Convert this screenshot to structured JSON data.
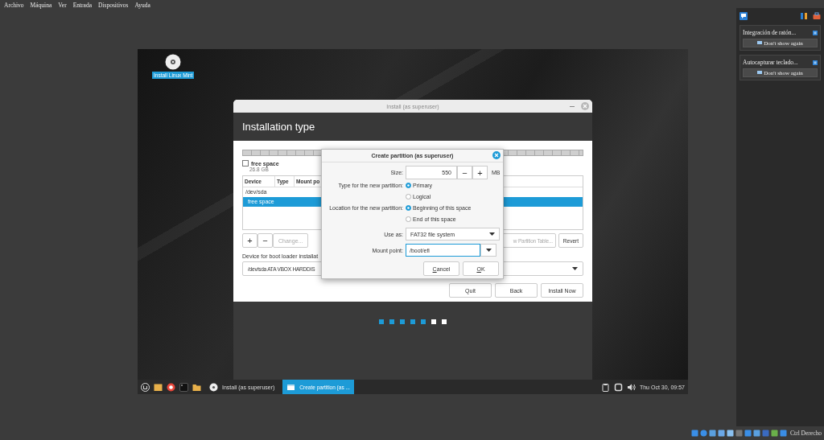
{
  "menubar": {
    "items": [
      "Archivo",
      "Máquina",
      "Ver",
      "Entrada",
      "Dispositivos",
      "Ayuda"
    ]
  },
  "desktop": {
    "icon_label": "Install Linux Mint"
  },
  "installer": {
    "title": "Install (as superuser)",
    "heading": "Installation type",
    "legend": {
      "label": "free space",
      "size": "26.8 GB"
    },
    "columns": [
      "Device",
      "Type",
      "Mount po"
    ],
    "rows": [
      {
        "device": "/dev/sda",
        "selected": false
      },
      {
        "device": "free space",
        "selected": true
      }
    ],
    "partition_buttons": [
      {
        "label": "+",
        "disabled": false
      },
      {
        "label": "−",
        "disabled": false
      },
      {
        "label": "Change...",
        "disabled": true
      }
    ],
    "table_button": {
      "label": "w Partition Table...",
      "disabled": true
    },
    "revert_button": "Revert",
    "bootloader_label": "Device for boot loader installat",
    "bootloader_value": "/dev/sda ATA VBOX HARDDIS",
    "nav_buttons": [
      "Quit",
      "Back",
      "Install Now"
    ],
    "steps": [
      {
        "done": true
      },
      {
        "done": true
      },
      {
        "done": true
      },
      {
        "done": true
      },
      {
        "done": true
      },
      {
        "done": false
      },
      {
        "done": false
      }
    ]
  },
  "dialog": {
    "title": "Create partition (as superuser)",
    "size": {
      "label": "Size:",
      "value": "550",
      "unit": "MB",
      "decrement": "−",
      "increment": "+"
    },
    "type": {
      "label": "Type for the new partition:",
      "options": [
        {
          "label": "Primary",
          "selected": true
        },
        {
          "label": "Logical",
          "selected": false
        }
      ]
    },
    "location": {
      "label": "Location for the new partition:",
      "options": [
        {
          "label": "Beginning of this space",
          "selected": true
        },
        {
          "label": "End of this space",
          "selected": false
        }
      ]
    },
    "use_as": {
      "label": "Use as:",
      "value": "FAT32 file system"
    },
    "mount_point": {
      "label": "Mount point:",
      "value": "/boot/efi"
    },
    "buttons": [
      "Cancel",
      "OK"
    ]
  },
  "taskbar": {
    "tasks": [
      {
        "label": "Install (as superuser)",
        "active": false,
        "kind": "disc"
      },
      {
        "label": "Create partition (as ...",
        "active": true,
        "kind": "window"
      }
    ],
    "clock": "Thu Oct 30, 09:57"
  },
  "notifications": [
    {
      "title": "Integración de ratón...",
      "button": "Don't show again"
    },
    {
      "title": "Autocapturar teclado...",
      "button": "Don't show again"
    }
  ],
  "status_bar": {
    "label": "Ctrl Derecho"
  }
}
